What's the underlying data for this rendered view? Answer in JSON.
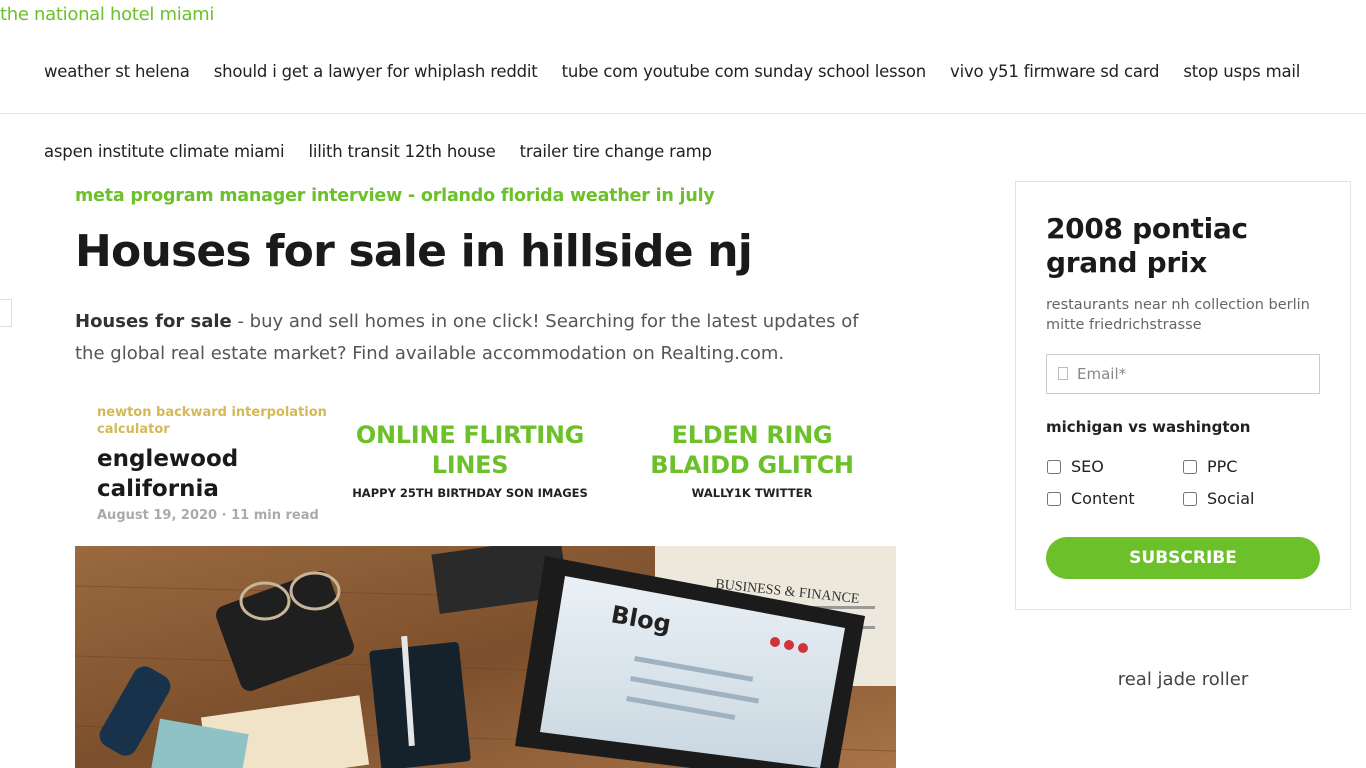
{
  "site": {
    "title": "the national hotel miami"
  },
  "nav": {
    "row1": [
      "weather st helena",
      "should i get a lawyer for whiplash reddit",
      "tube com youtube com sunday school lesson",
      "vivo y51 firmware sd card",
      "stop usps mail"
    ],
    "row2": [
      "aspen institute climate miami",
      "lilith transit 12th house",
      "trailer tire change ramp"
    ]
  },
  "article": {
    "breadcrumb": "meta program manager interview - orlando florida weather in july",
    "title": "Houses for sale in hillside nj",
    "intro_bold": "Houses for sale",
    "intro_rest": " - buy and sell homes in one click! Searching for the latest updates of the global real estate market? Find available accommodation on Realting.com.",
    "post": {
      "category": "newton backward interpolation calculator",
      "name": "englewood california",
      "date": "August 19, 2020 · 11 min read"
    },
    "features": [
      {
        "heading": "ONLINE FLIRTING LINES",
        "caption": "HAPPY 25TH BIRTHDAY SON IMAGES"
      },
      {
        "heading": "ELDEN RING BLAIDD GLITCH",
        "caption": "WALLY1K TWITTER"
      }
    ],
    "hero": {
      "laptop_text": "Blog",
      "newspaper_text": "BUSINESS & FINANCE"
    }
  },
  "sidebar": {
    "title": "2008 pontiac grand prix",
    "description": "restaurants near nh collection berlin mitte friedrichstrasse",
    "email_placeholder": "Email*",
    "subheading": "michigan vs washington",
    "options": [
      "SEO",
      "PPC",
      "Content",
      "Social"
    ],
    "subscribe_label": "SUBSCRIBE",
    "link": "real jade roller"
  },
  "colors": {
    "accent": "#6cc02a",
    "category": "#d4b85a"
  }
}
